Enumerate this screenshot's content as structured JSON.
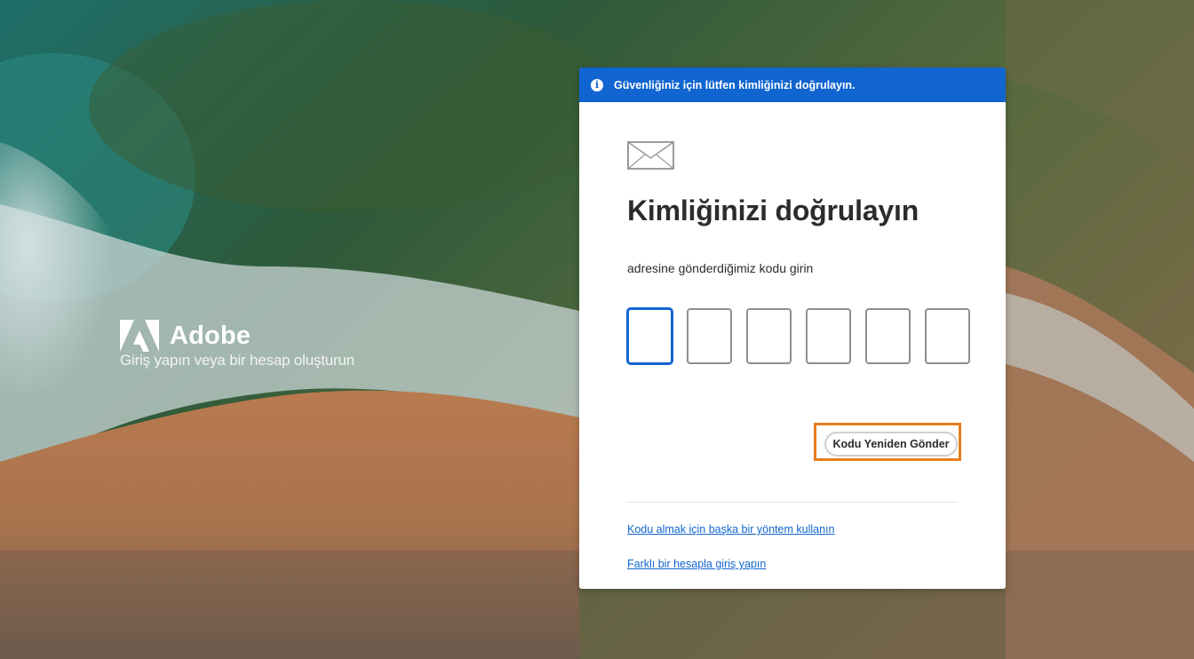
{
  "brand": {
    "name": "Adobe",
    "tagline": "Giriş yapın veya bir hesap oluşturun"
  },
  "banner": {
    "icon": "info-icon",
    "text": "Güvenliğiniz için lütfen kimliğinizi doğrulayın."
  },
  "card": {
    "icon": "mail-icon",
    "title": "Kimliğinizi doğrulayın",
    "subtitle": "adresine gönderdiğimiz kodu girin",
    "code_boxes": [
      "",
      "",
      "",
      "",
      "",
      ""
    ],
    "resend_label": "Kodu Yeniden Gönder",
    "links": {
      "alt_method": "Kodu almak için başka bir yöntem kullanın",
      "different_account": "Farklı bir hesapla giriş yapın"
    }
  },
  "colors": {
    "accent": "#1165d0",
    "highlight": "#e87d1e"
  }
}
